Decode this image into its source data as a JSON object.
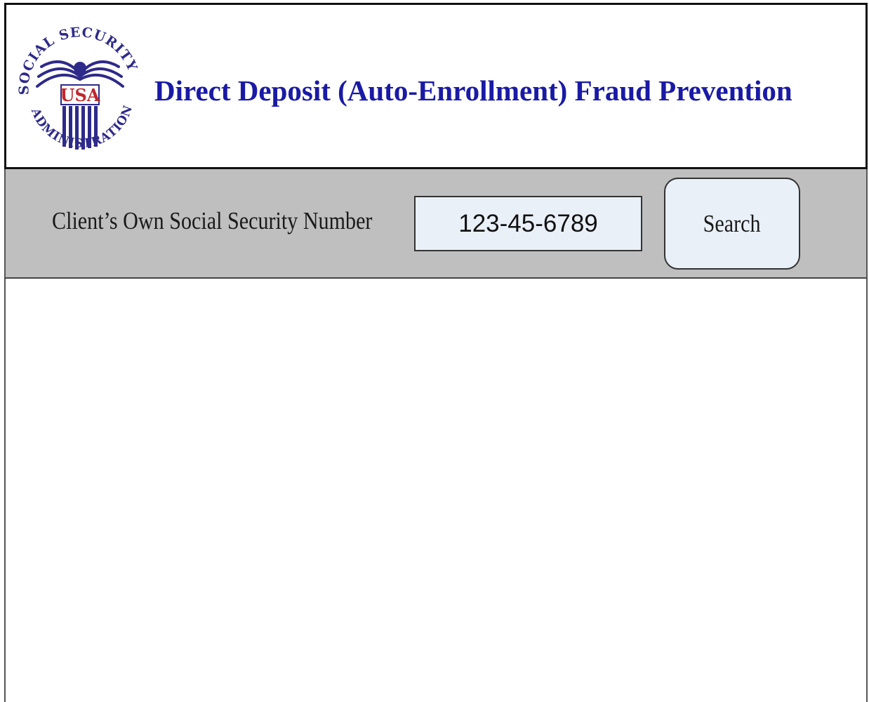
{
  "header": {
    "seal": {
      "icon": "ssa-seal-icon",
      "ring_text_top": "SOCIAL SECURITY",
      "ring_text_bottom": "ADMINISTRATION",
      "center_text": "USA"
    },
    "title": "Direct Deposit (Auto-Enrollment) Fraud Prevention",
    "title_color": "#1a1aa6"
  },
  "search": {
    "label": "Client’s Own Social Security Number",
    "ssn_value": "123-45-6789",
    "button_label": "Search",
    "bar_color": "#bfbfbf",
    "field_color": "#eaf0f8"
  },
  "results": {}
}
